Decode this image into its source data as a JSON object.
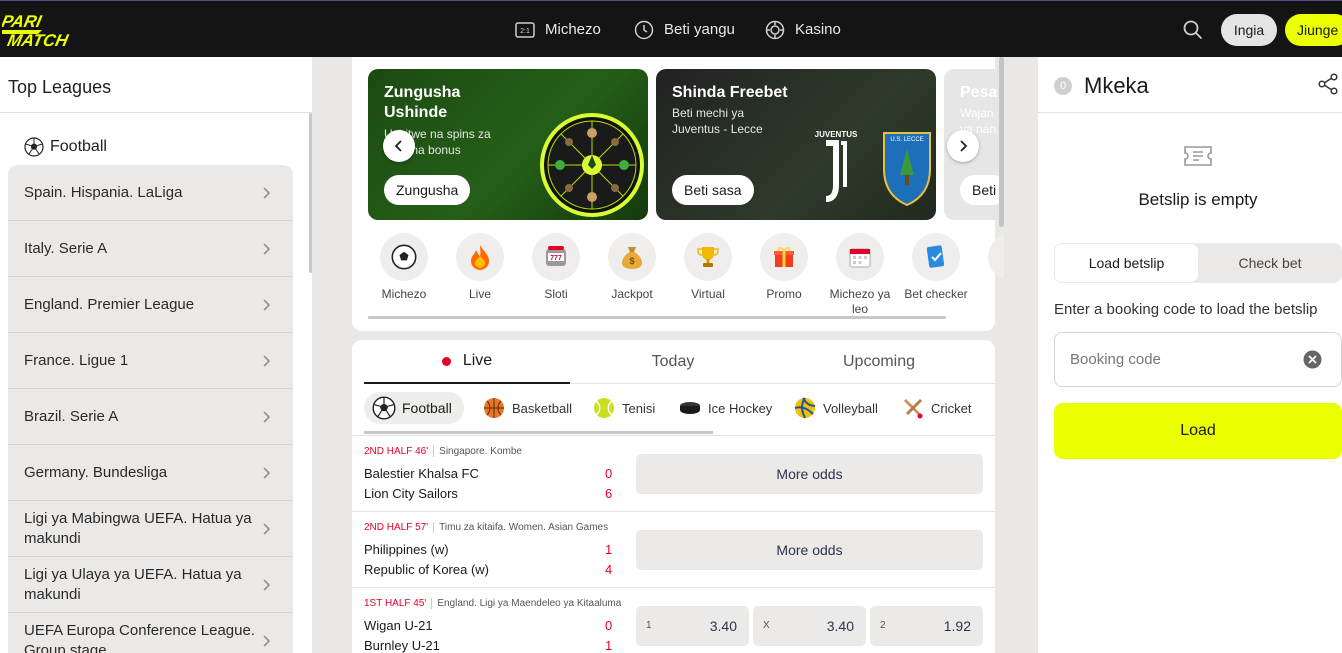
{
  "header": {
    "logo_text": "PARIMATCH",
    "nav": [
      {
        "label": "Michezo",
        "icon": "scoreboard-icon"
      },
      {
        "label": "Beti yangu",
        "icon": "clock-icon"
      },
      {
        "label": "Kasino",
        "icon": "casino-chip-icon"
      }
    ],
    "login_label": "Ingia",
    "signup_label": "Jiunge"
  },
  "sidebar": {
    "title": "Top Leagues",
    "sport_label": "Football",
    "leagues": [
      "Spain. Hispania. LaLiga",
      "Italy. Serie A",
      "England. Premier League",
      "France. Ligue 1",
      "Brazil. Serie A",
      "Germany. Bundesliga",
      "Ligi ya Mabingwa UEFA. Hatua ya makundi",
      "Ligi ya Ulaya ya UEFA. Hatua ya makundi",
      "UEFA Europa Conference League. Group stage"
    ]
  },
  "promos": [
    {
      "title_line1": "Zungusha",
      "title_line2": "Ushinde",
      "sub_line1": "Ushitwe na spins za",
      "sub_line2": "bure na bonus",
      "button": "Zungusha"
    },
    {
      "title_line1": "Shinda Freebet",
      "sub_line1": "Beti mechi ya",
      "sub_line2": "Juventus - Lecce",
      "button": "Beti sasa",
      "badge_left": "JUVENTUS",
      "badge_right": "U.S. LECCE"
    },
    {
      "title_line1": "Pesa",
      "sub_line1": "Wajan",
      "sub_line2": "ya nan",
      "button": "Beti"
    }
  ],
  "categories": [
    {
      "label": "Michezo",
      "icon": "soccer-ball-icon"
    },
    {
      "label": "Live",
      "icon": "flame-icon"
    },
    {
      "label": "Sloti",
      "icon": "slot-machine-icon"
    },
    {
      "label": "Jackpot",
      "icon": "money-bag-icon"
    },
    {
      "label": "Virtual",
      "icon": "trophy-icon"
    },
    {
      "label": "Promo",
      "icon": "gift-icon"
    },
    {
      "label": "Michezo ya leo",
      "icon": "calendar-icon"
    },
    {
      "label": "Bet checker",
      "icon": "ticket-check-icon"
    }
  ],
  "event_tabs": [
    "Live",
    "Today",
    "Upcoming"
  ],
  "sport_filters": [
    "Football",
    "Basketball",
    "Tenisi",
    "Ice Hockey",
    "Volleyball",
    "Cricket"
  ],
  "matches": [
    {
      "time": "2ND HALF 46'",
      "league": "Singapore. Kombe",
      "home": "Balestier Khalsa FC",
      "away": "Lion City Sailors",
      "home_score": "0",
      "away_score": "6",
      "more_odds": "More odds"
    },
    {
      "time": "2ND HALF 57'",
      "league": "Timu za kitaifa. Women. Asian Games",
      "home": "Philippines (w)",
      "away": "Republic of Korea (w)",
      "home_score": "1",
      "away_score": "4",
      "more_odds": "More odds"
    },
    {
      "time": "1ST HALF 45'",
      "league": "England. Ligi ya Maendeleo ya Kitaaluma",
      "home": "Wigan U-21",
      "away": "Burnley U-21",
      "home_score": "0",
      "away_score": "1",
      "odds": [
        {
          "label": "1",
          "value": "3.40"
        },
        {
          "label": "X",
          "value": "3.40"
        },
        {
          "label": "2",
          "value": "1.92"
        }
      ]
    }
  ],
  "betslip": {
    "count": "0",
    "title": "Mkeka",
    "empty_text": "Betslip is empty",
    "tab_load": "Load betslip",
    "tab_check": "Check bet",
    "hint": "Enter a booking code to load the betslip",
    "booking_placeholder": "Booking code",
    "load_button": "Load"
  },
  "colors": {
    "accent": "#eaff00",
    "live_red": "#e5002a",
    "header_bg": "#141414"
  }
}
